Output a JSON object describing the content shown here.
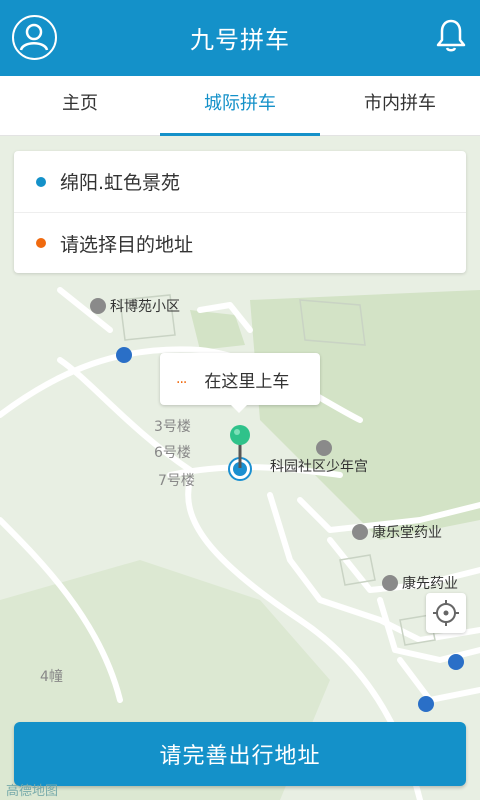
{
  "header": {
    "title": "九号拼车",
    "avatar_icon": "user-avatar-icon",
    "bell_icon": "bell-icon"
  },
  "tabs": [
    {
      "label": "主页",
      "active": false
    },
    {
      "label": "城际拼车",
      "active": true
    },
    {
      "label": "市内拼车",
      "active": false
    }
  ],
  "address": {
    "origin": "绵阳.虹色景苑",
    "destination_placeholder": "请选择目的地址"
  },
  "pickup_tooltip": {
    "dots": "...",
    "text": "在这里上车"
  },
  "map": {
    "labels": [
      {
        "text": "科博苑小区",
        "kind": "poi"
      },
      {
        "text": "3号楼",
        "kind": "building"
      },
      {
        "text": "6号楼",
        "kind": "building"
      },
      {
        "text": "7号楼",
        "kind": "building"
      },
      {
        "text": "科园社区少年宫",
        "kind": "poi"
      },
      {
        "text": "康乐堂药业",
        "kind": "poi"
      },
      {
        "text": "康先药业",
        "kind": "poi"
      },
      {
        "text": "4幢",
        "kind": "building"
      }
    ],
    "watermark": "高德地图"
  },
  "actions": {
    "submit_label": "请完善出行地址"
  },
  "colors": {
    "primary": "#1491c9",
    "origin_dot": "#1491c9",
    "destination_dot": "#f06a0f",
    "map_bg": "#e8efe3"
  }
}
